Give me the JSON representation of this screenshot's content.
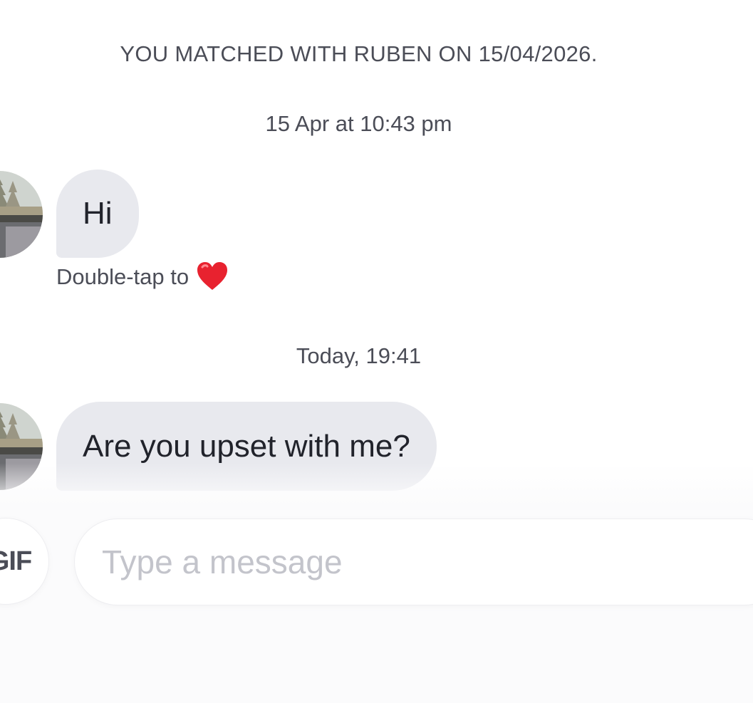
{
  "match_banner": "YOU MATCHED WITH RUBEN ON 15/04/2026.",
  "messages": [
    {
      "timestamp": "15 Apr at 10:43 pm",
      "text": "Hi",
      "reaction_hint": "Double-tap to",
      "reaction_icon": "heart-icon"
    },
    {
      "timestamp": "Today, 19:41",
      "text": "Are you upset with me?"
    }
  ],
  "composer": {
    "gif_label": "GIF",
    "placeholder": "Type a message",
    "value": ""
  },
  "colors": {
    "bubble": "#e8e9ee",
    "text": "#21232b",
    "meta_text": "#4b4d57",
    "heart": "#e8222f"
  }
}
